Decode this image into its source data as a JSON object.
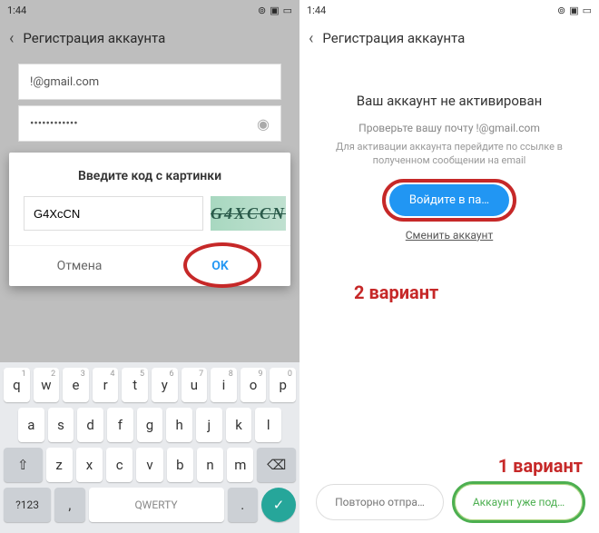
{
  "status": {
    "time": "1:44"
  },
  "header": {
    "title": "Регистрация аккаунта"
  },
  "left": {
    "email": "!@gmail.com",
    "password_mask": "••••••••••••",
    "modal": {
      "title": "Введите код с картинки",
      "input_value": "G4XcCN",
      "captcha_text": "G4XCCN",
      "cancel": "Отмена",
      "ok": "OK"
    },
    "keyboard": {
      "row1": [
        "q",
        "w",
        "e",
        "r",
        "t",
        "y",
        "u",
        "i",
        "o",
        "p"
      ],
      "row1sup": [
        "1",
        "2",
        "3",
        "4",
        "5",
        "6",
        "7",
        "8",
        "9",
        "0"
      ],
      "row2": [
        "a",
        "s",
        "d",
        "f",
        "g",
        "h",
        "j",
        "k",
        "l"
      ],
      "row3": [
        "z",
        "x",
        "c",
        "v",
        "b",
        "n",
        "m"
      ],
      "sym": "?123",
      "space": "QWERTY"
    }
  },
  "right": {
    "title": "Ваш аккаунт не активирован",
    "check_email": "Проверьте вашу почту        !@gmail.com",
    "desc": "Для активации аккаунта перейдите по ссылке в полученном сообщении на email",
    "login_btn": "Войдите в па…",
    "change_account": "Сменить аккаунт",
    "resend": "Повторно отпра…",
    "confirmed": "Аккаунт уже под…"
  },
  "annotations": {
    "variant1": "1 вариант",
    "variant2": "2 вариант"
  }
}
